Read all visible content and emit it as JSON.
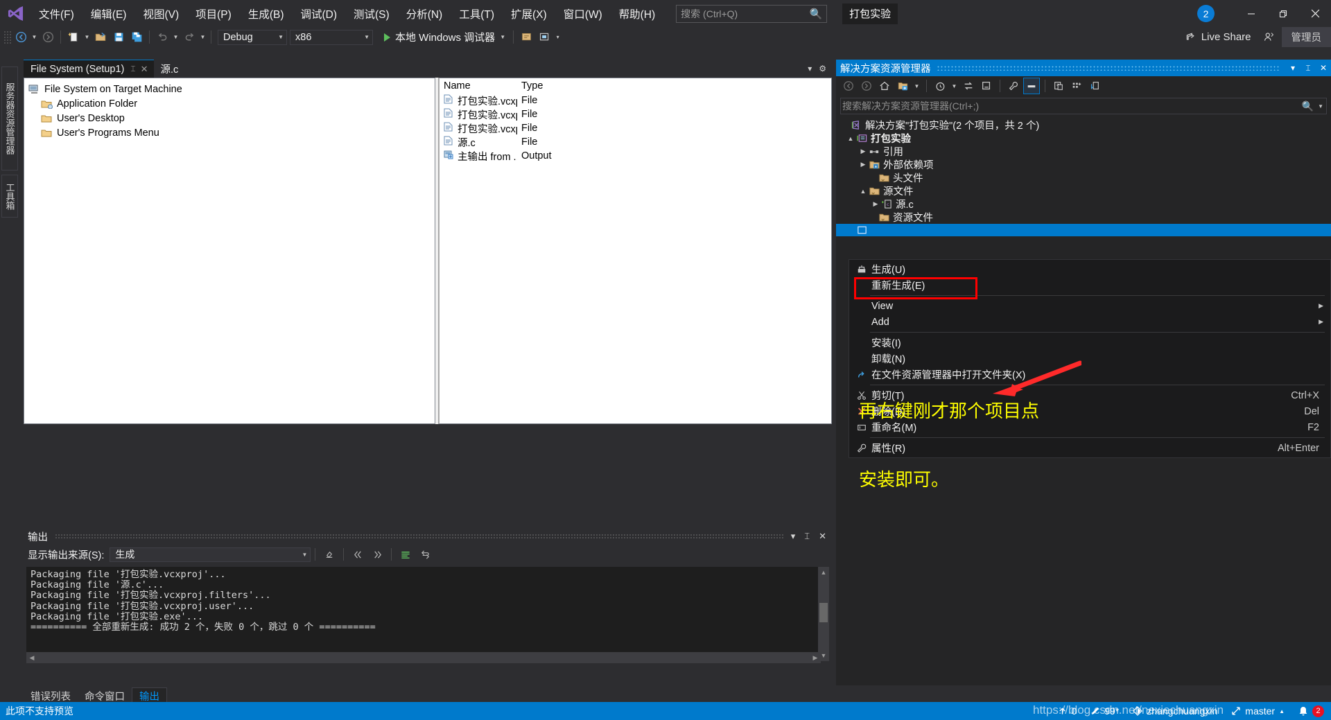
{
  "app": {
    "logo": "visual-studio-logo",
    "project_pill": "打包实验",
    "notification_count": "2"
  },
  "menubar": {
    "items": [
      {
        "label": "文件(F)"
      },
      {
        "label": "编辑(E)"
      },
      {
        "label": "视图(V)"
      },
      {
        "label": "项目(P)"
      },
      {
        "label": "生成(B)"
      },
      {
        "label": "调试(D)"
      },
      {
        "label": "测试(S)"
      },
      {
        "label": "分析(N)"
      },
      {
        "label": "工具(T)"
      },
      {
        "label": "扩展(X)"
      },
      {
        "label": "窗口(W)"
      },
      {
        "label": "帮助(H)"
      }
    ]
  },
  "search": {
    "placeholder": "搜索 (Ctrl+Q)",
    "icon": "search-icon"
  },
  "window_controls": {
    "minimize": "–",
    "restore": "❐",
    "close": "✕"
  },
  "toolbar": {
    "nav_back": "back-arrow-icon",
    "nav_forward": "forward-arrow-icon",
    "new_item": "new-item-icon",
    "open_file": "open-folder-icon",
    "save": "save-icon",
    "save_all": "save-all-icon",
    "undo": "undo-icon",
    "redo": "redo-icon",
    "configuration": "Debug",
    "platform": "x86",
    "run_label": "本地 Windows 调试器",
    "run_icon": "play-icon"
  },
  "toolbar_right": {
    "live_share": "Live Share",
    "live_share_icon": "share-icon",
    "add_account_icon": "person-add-icon",
    "account": "管理员"
  },
  "vertical_tabs": [
    {
      "label": "服务器资源管理器"
    },
    {
      "label": "工具箱"
    }
  ],
  "document_tabs": {
    "tabs": [
      {
        "label": "File System (Setup1)",
        "active": true,
        "pin": "📌",
        "close": "✕"
      },
      {
        "label": "源.c",
        "active": false
      }
    ],
    "chevron_icon": "chevron-down-icon",
    "settings_icon": "gear-icon"
  },
  "file_system_tree": {
    "nodes": [
      {
        "label": "File System on Target Machine",
        "icon": "computer-icon",
        "level": 0
      },
      {
        "label": "Application Folder",
        "icon": "folder-app-icon",
        "level": 1
      },
      {
        "label": "User's Desktop",
        "icon": "folder-icon",
        "level": 1
      },
      {
        "label": "User's Programs Menu",
        "icon": "folder-icon",
        "level": 1
      }
    ]
  },
  "file_list": {
    "columns": [
      "Name",
      "Type"
    ],
    "rows": [
      {
        "name": "打包实验.vcxp...",
        "type": "File",
        "icon": "file-icon"
      },
      {
        "name": "打包实验.vcxp...",
        "type": "File",
        "icon": "file-icon"
      },
      {
        "name": "打包实验.vcxp...",
        "type": "File",
        "icon": "file-icon"
      },
      {
        "name": "源.c",
        "type": "File",
        "icon": "file-icon"
      },
      {
        "name": "主输出 from ...",
        "type": "Output",
        "icon": "output-icon"
      }
    ]
  },
  "output_pane": {
    "title": "输出",
    "pin_icon": "pin-icon",
    "close_icon": "close-icon",
    "chevron_icon": "chevron-down-icon",
    "source_label": "显示输出来源(S):",
    "source_value": "生成",
    "toolbar_icons": [
      "clear-all-icon",
      "jump-prev-icon",
      "jump-next-icon",
      "toggle-wordwrap-icon",
      "toggle-autoscroll-icon"
    ],
    "lines": [
      "Packaging file '打包实验.vcxproj'...",
      "Packaging file '源.c'...",
      "Packaging file '打包实验.vcxproj.filters'...",
      "Packaging file '打包实验.vcxproj.user'...",
      "Packaging file '打包实验.exe'...",
      "========== 全部重新生成: 成功 2 个，失败 0 个，跳过 0 个 =========="
    ]
  },
  "bottom_tabs": [
    {
      "label": "错误列表",
      "active": false
    },
    {
      "label": "命令窗口",
      "active": false
    },
    {
      "label": "输出",
      "active": true
    }
  ],
  "solution_explorer": {
    "title": "解决方案资源管理器",
    "header_buttons": [
      "chevron-down-icon",
      "pin-icon",
      "close-icon"
    ],
    "toolbar_icons": [
      "back-arrow-icon",
      "forward-arrow-icon",
      "home-icon",
      "new-folder-icon",
      "pending-changes-icon",
      "sync-icon",
      "collapse-all-icon",
      "properties-icon",
      "show-all-files-icon",
      "preview-selected-icon",
      "view-class-icon",
      "sync-views-icon"
    ],
    "search_placeholder": "搜索解决方案资源管理器(Ctrl+;)",
    "search_icon": "search-icon",
    "tree": [
      {
        "label": "解决方案\"打包实验\"(2 个项目，共 2 个)",
        "level": 0,
        "icon": "solution-icon",
        "expander": "",
        "bold": false
      },
      {
        "label": "打包实验",
        "level": 1,
        "icon": "project-icon",
        "expander": "▲",
        "bold": true
      },
      {
        "label": "引用",
        "level": 2,
        "icon": "references-icon",
        "expander": "▶",
        "bold": false
      },
      {
        "label": "外部依赖项",
        "level": 2,
        "icon": "ext-deps-icon",
        "expander": "▶",
        "bold": false
      },
      {
        "label": "头文件",
        "level": 2,
        "icon": "filter-folder-icon",
        "expander": "",
        "bold": false
      },
      {
        "label": "源文件",
        "level": 2,
        "icon": "filter-folder-icon",
        "expander": "▲",
        "bold": false
      },
      {
        "label": "源.c",
        "level": 3,
        "icon": "c-file-icon",
        "expander": "▶",
        "bold": false
      },
      {
        "label": "资源文件",
        "level": 2,
        "icon": "filter-folder-icon",
        "expander": "",
        "bold": false
      },
      {
        "label": "",
        "level": 1,
        "icon": "setup-project-icon",
        "expander": "",
        "bold": false,
        "selected": true
      }
    ]
  },
  "context_menu": {
    "items": [
      {
        "label": "生成(U)",
        "icon": "build-icon",
        "shortcut": "",
        "submenu": false
      },
      {
        "label": "重新生成(E)",
        "icon": "",
        "shortcut": "",
        "submenu": false
      },
      {
        "separator": true
      },
      {
        "label": "View",
        "icon": "",
        "shortcut": "",
        "submenu": true
      },
      {
        "label": "Add",
        "icon": "",
        "shortcut": "",
        "submenu": true
      },
      {
        "separator": true
      },
      {
        "label": "安装(I)",
        "icon": "",
        "shortcut": "",
        "submenu": false,
        "highlighted": true
      },
      {
        "label": "卸载(N)",
        "icon": "",
        "shortcut": "",
        "submenu": false
      },
      {
        "label": "在文件资源管理器中打开文件夹(X)",
        "icon": "open-folder-arrow-icon",
        "shortcut": "",
        "submenu": false
      },
      {
        "separator": true
      },
      {
        "label": "剪切(T)",
        "icon": "scissors-icon",
        "shortcut": "Ctrl+X",
        "submenu": false
      },
      {
        "label": "删除(D)",
        "icon": "delete-x-icon",
        "shortcut": "Del",
        "submenu": false
      },
      {
        "label": "重命名(M)",
        "icon": "rename-icon",
        "shortcut": "F2",
        "submenu": false
      },
      {
        "separator": true
      },
      {
        "label": "属性(R)",
        "icon": "wrench-icon",
        "shortcut": "Alt+Enter",
        "submenu": false
      }
    ]
  },
  "annotation": {
    "line1": "再右键刚才那个项目点",
    "line2": "安装即可。",
    "color": "#ffff00",
    "highlight_color": "#ff0000",
    "arrow_color": "#ff2a2a"
  },
  "status_bar": {
    "message": "此项不支持预览",
    "push_count": "0",
    "push_icon": "arrow-up-icon",
    "pending_changes": "99*",
    "pencil_icon": "pencil-icon",
    "repo": "zhangchuangxin",
    "repo_icon": "source-control-icon",
    "branch": "master",
    "branch_icon": "branch-icon",
    "notifications_icon": "bell-icon",
    "error_count": "2"
  },
  "watermark": "https://blog.csdn.net/nexiechuangxin"
}
